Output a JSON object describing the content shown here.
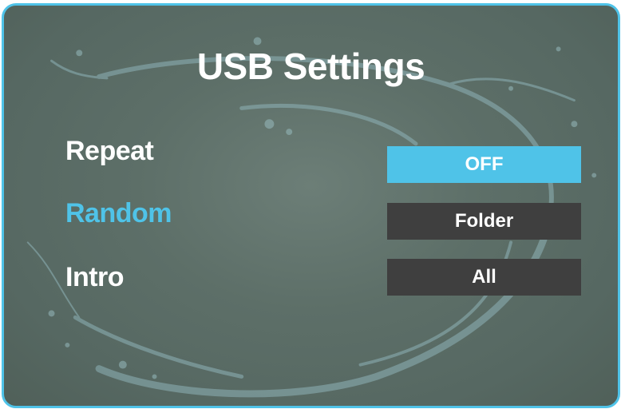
{
  "screen": {
    "title": "USB Settings",
    "accent_color": "#4fc3e8",
    "panel_border_color": "#4fc3e8",
    "value_box_color": "#3f3f3f",
    "background_image": "water-splash"
  },
  "settings": [
    {
      "label": "Repeat",
      "value": "OFF",
      "label_highlighted": false,
      "value_selected": true
    },
    {
      "label": "Random",
      "value": "Folder",
      "label_highlighted": true,
      "value_selected": false
    },
    {
      "label": "Intro",
      "value": "All",
      "label_highlighted": false,
      "value_selected": false
    }
  ]
}
